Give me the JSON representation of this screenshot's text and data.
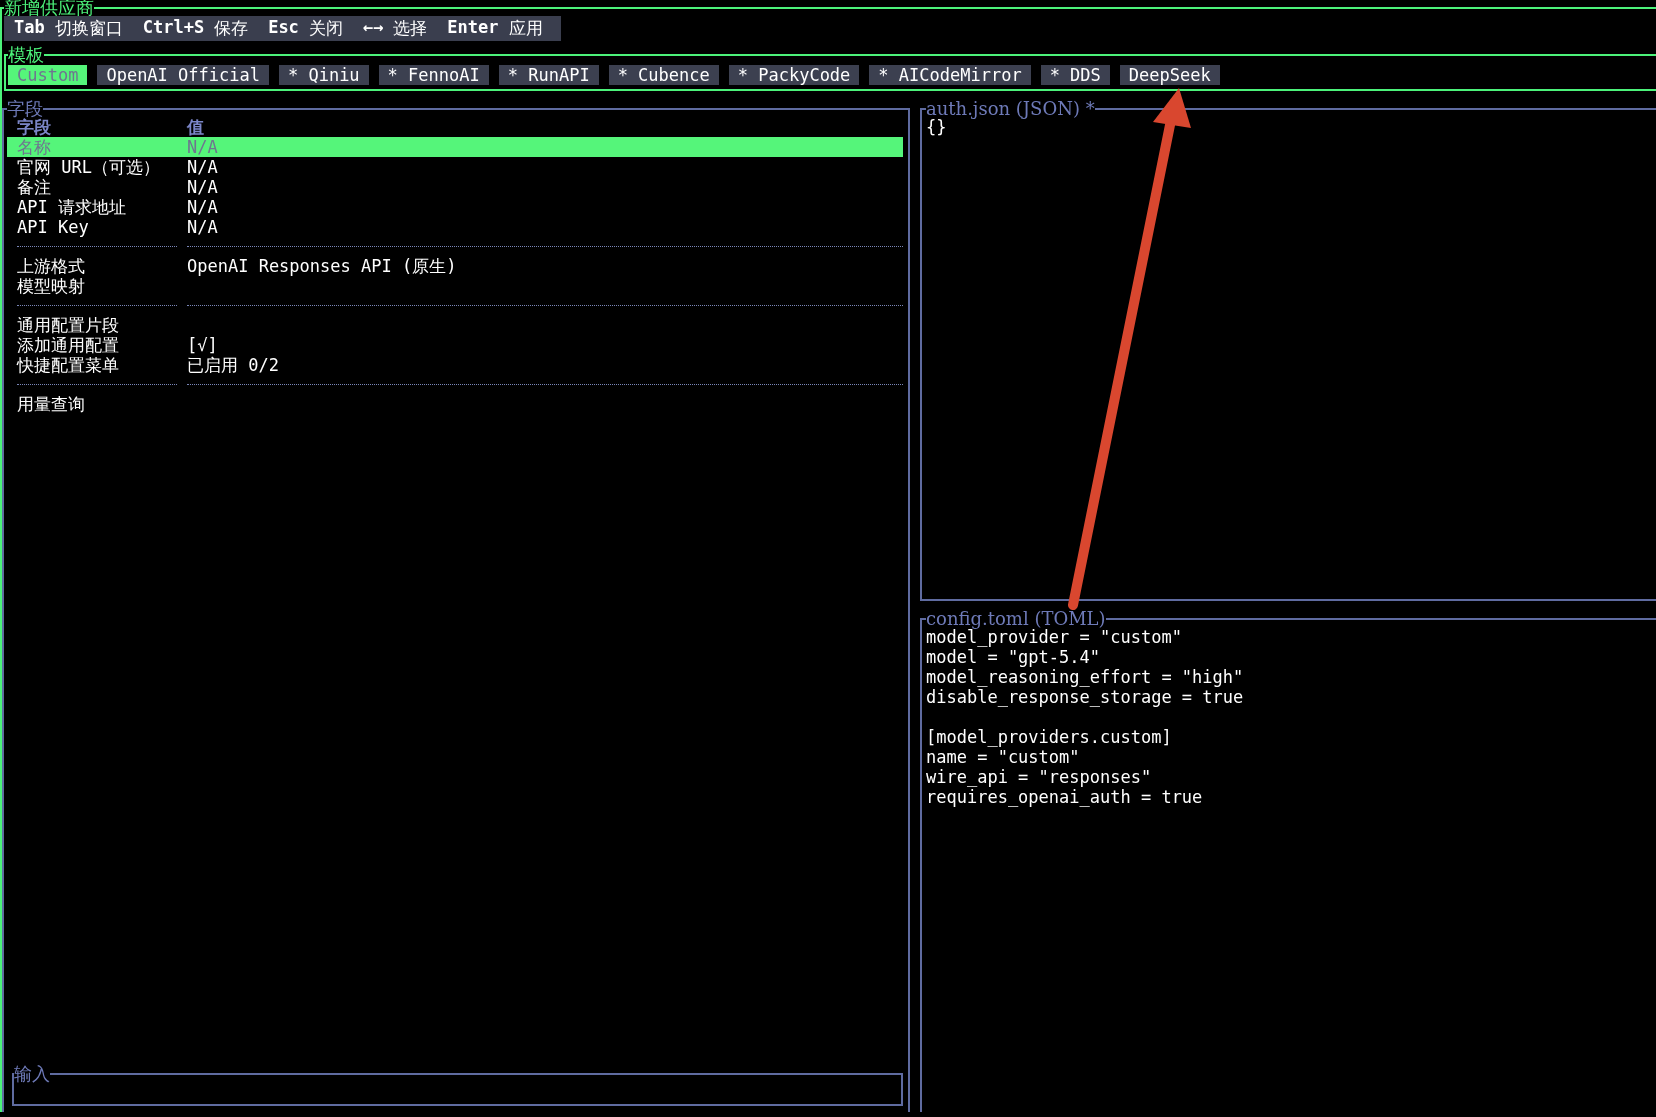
{
  "window": {
    "title": "新增供应商"
  },
  "shortcuts": [
    {
      "key": "Tab",
      "action": "切换窗口"
    },
    {
      "key": "Ctrl+S",
      "action": "保存"
    },
    {
      "key": "Esc",
      "action": "关闭"
    },
    {
      "key": "←→",
      "action": "选择"
    },
    {
      "key": "Enter",
      "action": "应用"
    }
  ],
  "templates": {
    "title": "模板",
    "tabs": [
      {
        "label": "Custom",
        "selected": true
      },
      {
        "label": "OpenAI Official",
        "selected": false
      },
      {
        "label": "* Qiniu",
        "selected": false
      },
      {
        "label": "* FennoAI",
        "selected": false
      },
      {
        "label": "* RunAPI",
        "selected": false
      },
      {
        "label": "* Cubence",
        "selected": false
      },
      {
        "label": "* PackyCode",
        "selected": false
      },
      {
        "label": "* AICodeMirror",
        "selected": false
      },
      {
        "label": "* DDS",
        "selected": false
      },
      {
        "label": "DeepSeek",
        "selected": false
      }
    ]
  },
  "fields": {
    "title": "字段",
    "columns": [
      "字段",
      "值"
    ],
    "groups": [
      [
        {
          "field": "名称",
          "value": "N/A",
          "selected": true
        },
        {
          "field": "官网 URL（可选）",
          "value": "N/A",
          "selected": false
        },
        {
          "field": "备注",
          "value": "N/A",
          "selected": false
        },
        {
          "field": "API 请求地址",
          "value": "N/A",
          "selected": false
        },
        {
          "field": "API Key",
          "value": "N/A",
          "selected": false
        }
      ],
      [
        {
          "field": "上游格式",
          "value": "OpenAI Responses API (原生)",
          "selected": false
        },
        {
          "field": "模型映射",
          "selected": false
        }
      ],
      [
        {
          "field": "通用配置片段",
          "selected": false
        },
        {
          "field": "添加通用配置",
          "value": "[√]",
          "selected": false
        },
        {
          "field": "快捷配置菜单",
          "value": "已启用 0/2",
          "selected": false
        }
      ],
      [
        {
          "field": "用量查询",
          "selected": false
        }
      ]
    ]
  },
  "input": {
    "title": "输入"
  },
  "auth_json": {
    "title": "auth.json (JSON) *",
    "blocks": [
      [
        "{}"
      ]
    ]
  },
  "config_toml": {
    "title": "config.toml (TOML)",
    "blocks": [
      [
        "model_provider = \"custom\"",
        "model = \"gpt-5.4\"",
        "model_reasoning_effort = \"high\"",
        "disable_response_storage = true"
      ],
      [
        "[model_providers.custom]",
        "name = \"custom\"",
        "wire_api = \"responses\"",
        "requires_openai_auth = true"
      ]
    ]
  },
  "annotation": {
    "kind": "arrow"
  }
}
